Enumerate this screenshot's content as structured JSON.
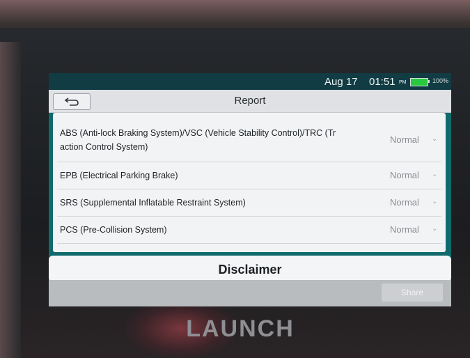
{
  "status_bar": {
    "date": "Aug 17",
    "time": "01:51",
    "ampm": "PM",
    "battery_percent": "100%",
    "battery_level": 1.0,
    "battery_color": "#28c840"
  },
  "header": {
    "back_icon": "back-arrow-icon",
    "title": "Report"
  },
  "report": {
    "rows": [
      {
        "label_line1": "ABS (Anti-lock Braking System)/VSC (Vehicle Stability Control)/TRC (Tr",
        "label_line2": "action Control System)",
        "status": "Normal"
      },
      {
        "label_line1": "EPB (Electrical Parking Brake)",
        "status": "Normal"
      },
      {
        "label_line1": "SRS (Supplemental Inflatable Restraint System)",
        "status": "Normal"
      },
      {
        "label_line1": "PCS (Pre-Collision System)",
        "status": "Normal"
      }
    ]
  },
  "disclaimer": {
    "label": "Disclaimer"
  },
  "footer": {
    "share_label": "Share"
  },
  "device": {
    "brand": "LAUNCH"
  }
}
